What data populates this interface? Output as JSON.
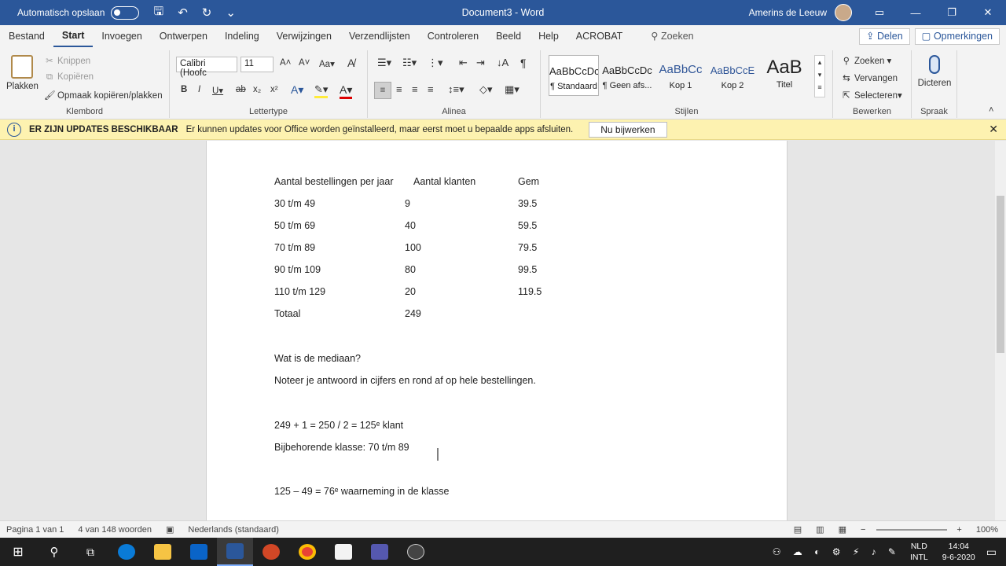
{
  "titlebar": {
    "autosave": "Automatisch opslaan",
    "doc_title": "Document3 - Word",
    "user": "Amerins de Leeuw"
  },
  "menu": {
    "tabs": [
      "Bestand",
      "Start",
      "Invoegen",
      "Ontwerpen",
      "Indeling",
      "Verwijzingen",
      "Verzendlijsten",
      "Controleren",
      "Beeld",
      "Help",
      "ACROBAT"
    ],
    "search": "Zoeken",
    "share": "Delen",
    "comments": "Opmerkingen"
  },
  "ribbon": {
    "clipboard": {
      "paste": "Plakken",
      "cut": "Knippen",
      "copy": "Kopiëren",
      "format_painter": "Opmaak kopiëren/plakken",
      "label": "Klembord"
    },
    "font": {
      "name": "Calibri (Hoofc",
      "size": "11",
      "label": "Lettertype"
    },
    "paragraph": {
      "label": "Alinea"
    },
    "styles": {
      "items": [
        {
          "sample": "AaBbCcDc",
          "name": "¶ Standaard"
        },
        {
          "sample": "AaBbCcDc",
          "name": "¶ Geen afs..."
        },
        {
          "sample": "AaBbCc",
          "name": "Kop 1"
        },
        {
          "sample": "AaBbCcE",
          "name": "Kop 2"
        },
        {
          "sample": "AaB",
          "name": "Titel"
        }
      ],
      "label": "Stijlen"
    },
    "editing": {
      "find": "Zoeken",
      "replace": "Vervangen",
      "select": "Selecteren",
      "label": "Bewerken"
    },
    "voice": {
      "dictate": "Dicteren",
      "label": "Spraak"
    }
  },
  "infobar": {
    "title": "ER ZIJN UPDATES BESCHIKBAAR",
    "message": "Er kunnen updates voor Office worden geïnstalleerd, maar eerst moet u bepaalde apps afsluiten.",
    "button": "Nu bijwerken"
  },
  "document": {
    "table_headers": [
      "Aantal bestellingen per jaar",
      "Aantal klanten",
      "Gem"
    ],
    "rows": [
      {
        "c1": "30 t/m 49",
        "c2": "9",
        "c3": "39.5"
      },
      {
        "c1": "50 t/m 69",
        "c2": "40",
        "c3": "59.5"
      },
      {
        "c1": "70 t/m 89",
        "c2": "100",
        "c3": "79.5"
      },
      {
        "c1": "90 t/m 109",
        "c2": "80",
        "c3": "99.5"
      },
      {
        "c1": "110 t/m 129",
        "c2": "20",
        "c3": "119.5"
      },
      {
        "c1": "Totaal",
        "c2": "249",
        "c3": ""
      }
    ],
    "question": "Wat is de mediaan?",
    "instruction": "Noteer je antwoord in cijfers en rond af op hele bestellingen.",
    "calc1": "249 + 1 = 250 / 2 = 125ᵉ klant",
    "calc2": "Bijbehorende klasse: 70 t/m 89",
    "calc3": "125 – 49 = 76ᵉ waarneming in de klasse"
  },
  "status": {
    "page": "Pagina 1 van 1",
    "words": "4 van 148 woorden",
    "language": "Nederlands (standaard)",
    "zoom": "100%"
  },
  "taskbar": {
    "lang1": "NLD",
    "lang2": "INTL",
    "time": "14:04",
    "date": "9-6-2020"
  }
}
